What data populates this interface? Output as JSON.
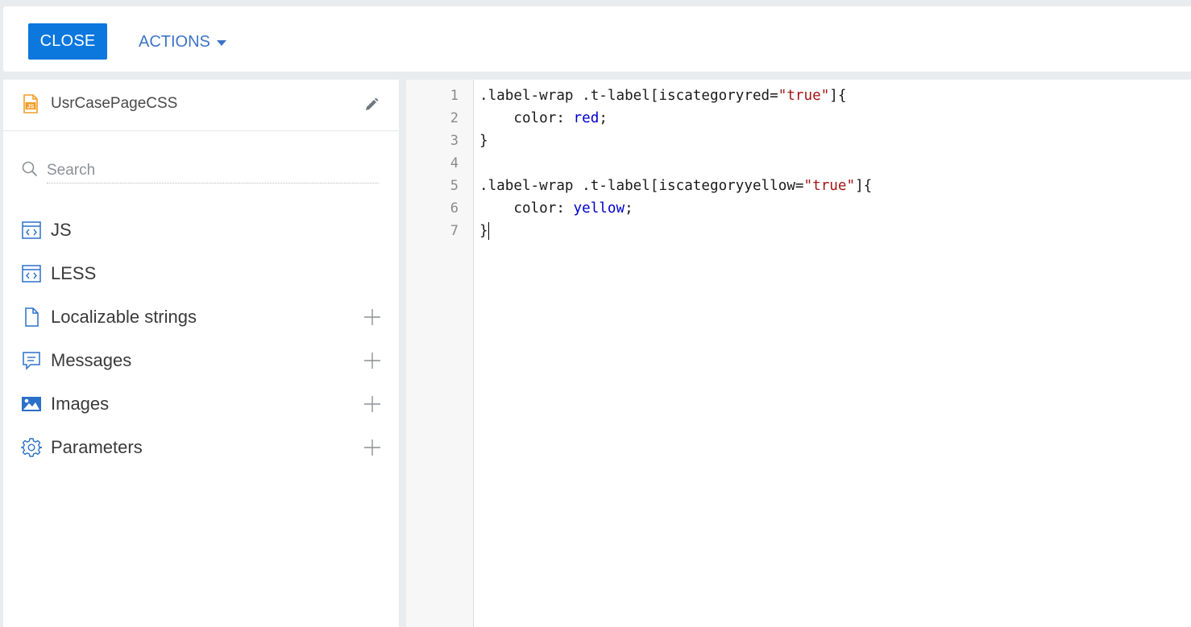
{
  "toolbar": {
    "close_label": "CLOSE",
    "actions_label": "ACTIONS"
  },
  "schema": {
    "name": "UsrCasePageCSS",
    "icon_text": "JS"
  },
  "search": {
    "placeholder": "Search",
    "value": ""
  },
  "nav": {
    "items": [
      {
        "label": "JS",
        "icon": "code-file-icon",
        "addable": false
      },
      {
        "label": "LESS",
        "icon": "code-file-icon",
        "addable": false
      },
      {
        "label": "Localizable strings",
        "icon": "document-icon",
        "addable": true
      },
      {
        "label": "Messages",
        "icon": "message-icon",
        "addable": true
      },
      {
        "label": "Images",
        "icon": "image-icon",
        "addable": true
      },
      {
        "label": "Parameters",
        "icon": "gear-icon",
        "addable": true
      }
    ]
  },
  "editor": {
    "line_numbers": [
      "1",
      "2",
      "3",
      "4",
      "5",
      "6",
      "7"
    ],
    "lines": [
      {
        "a": ".label-wrap .t-label[iscategoryred=",
        "s": "\"true\"",
        "b": "]{"
      },
      {
        "a": "    color: ",
        "v": "red",
        "b": ";"
      },
      {
        "a": "}"
      },
      {
        "a": ""
      },
      {
        "a": ".label-wrap .t-label[iscategoryyellow=",
        "s": "\"true\"",
        "b": "]{"
      },
      {
        "a": "    color: ",
        "v": "yellow",
        "b": ";"
      },
      {
        "a": "}"
      }
    ]
  },
  "colors": {
    "primary_button": "#0c78de",
    "link": "#3d73c7",
    "icon_blue": "#2a70c8",
    "schema_icon_orange": "#f09e28",
    "string_token": "#a31515",
    "value_token": "#0000cc"
  }
}
